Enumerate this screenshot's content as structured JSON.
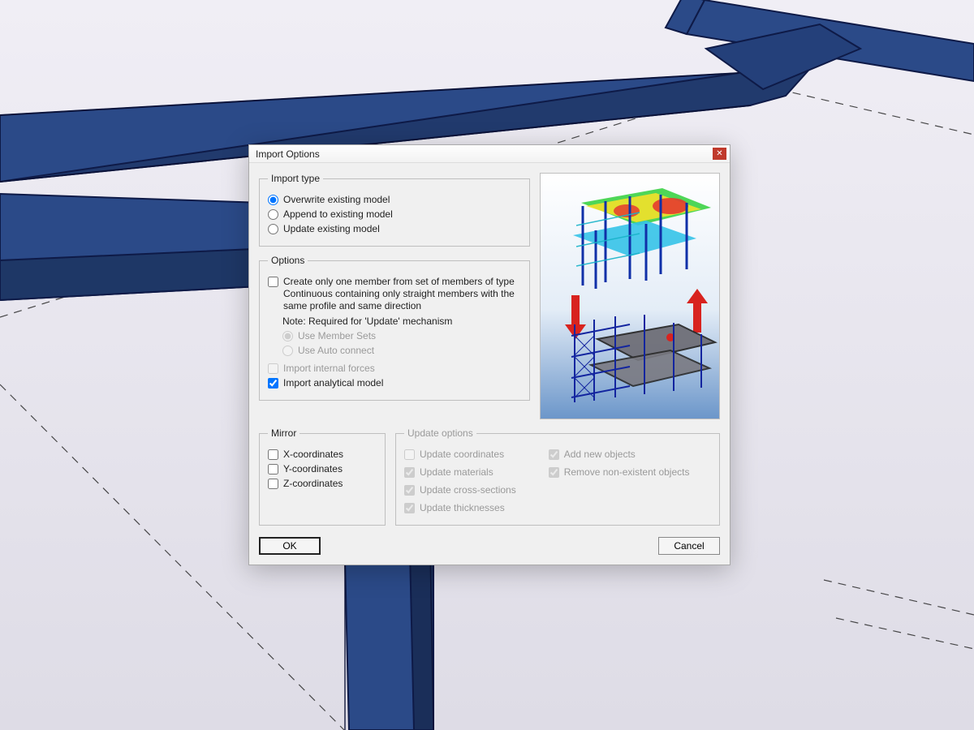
{
  "dialog": {
    "title": "Import Options",
    "importType": {
      "legend": "Import type",
      "overwrite": "Overwrite existing model",
      "append": "Append to existing model",
      "update": "Update existing model"
    },
    "options": {
      "legend": "Options",
      "createContinuous": "Create only one member from set of members of type Continuous containing only straight members with the same profile and same direction",
      "note": "Note: Required for 'Update' mechanism",
      "useMemberSets": "Use Member Sets",
      "useAutoConnect": "Use Auto connect",
      "importInternalForces": "Import internal forces",
      "importAnalytical": "Import analytical model"
    },
    "mirror": {
      "legend": "Mirror",
      "x": "X-coordinates",
      "y": "Y-coordinates",
      "z": "Z-coordinates"
    },
    "updateOptions": {
      "legend": "Update options",
      "updateCoordinates": "Update coordinates",
      "updateMaterials": "Update materials",
      "updateCrossSections": "Update cross-sections",
      "updateThicknesses": "Update thicknesses",
      "addNewObjects": "Add new objects",
      "removeNonExistent": "Remove non-existent objects"
    },
    "buttons": {
      "ok": "OK",
      "cancel": "Cancel"
    }
  },
  "state": {
    "importTypeSelected": "overwrite",
    "options": {
      "createContinuous": false,
      "useMemberSets": true,
      "useAutoConnect": false,
      "importInternalForces": false,
      "importAnalytical": true
    },
    "mirror": {
      "x": false,
      "y": false,
      "z": false
    },
    "updateOptions": {
      "updateCoordinates": false,
      "updateMaterials": true,
      "updateCrossSections": true,
      "updateThicknesses": true,
      "addNewObjects": true,
      "removeNonExistent": true
    },
    "updateOptionsEnabled": false,
    "subOptionsEnabled": false,
    "importInternalForcesEnabled": false
  }
}
